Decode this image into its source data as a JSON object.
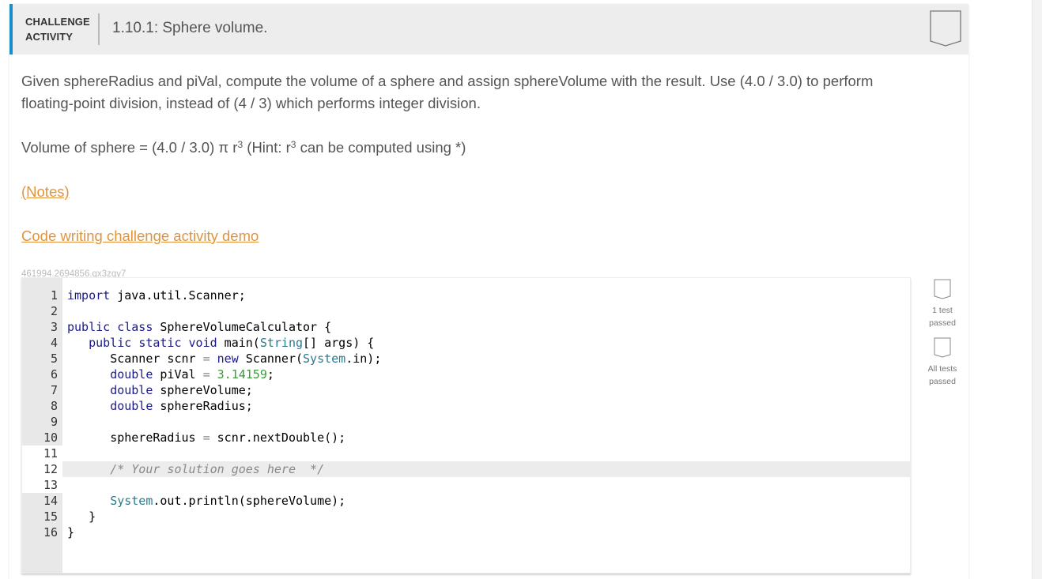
{
  "header": {
    "label_line1": "CHALLENGE",
    "label_line2": "ACTIVITY",
    "title": "1.10.1: Sphere volume.",
    "badge_icon": "completion-badge-icon",
    "accent_color": "#1a8cc7"
  },
  "instructions": {
    "paragraph": "Given sphereRadius and piVal, compute the volume of a sphere and assign sphereVolume with the result. Use (4.0 / 3.0) to perform floating-point division, instead of (4 / 3) which performs integer division.",
    "formula_prefix": "Volume of sphere = (4.0 / 3.0) π r",
    "formula_exp1": "3",
    "formula_middle": " (Hint: r",
    "formula_exp2": "3",
    "formula_suffix": " can be computed using *)"
  },
  "links": {
    "notes": "(Notes)",
    "demo": "Code writing challenge activity demo",
    "link_color": "#e2933b"
  },
  "activity_id": "461994.2694856.qx3zqy7",
  "editor": {
    "lines": [
      {
        "n": "1"
      },
      {
        "n": "2"
      },
      {
        "n": "3"
      },
      {
        "n": "4"
      },
      {
        "n": "5"
      },
      {
        "n": "6"
      },
      {
        "n": "7"
      },
      {
        "n": "8"
      },
      {
        "n": "9"
      },
      {
        "n": "10"
      },
      {
        "n": "11"
      },
      {
        "n": "12"
      },
      {
        "n": "13"
      },
      {
        "n": "14"
      },
      {
        "n": "15"
      },
      {
        "n": "16"
      }
    ],
    "tokens": {
      "l1_kw": "import",
      "l1_rest": " java.util.Scanner;",
      "l3_kw1": "public",
      "l3_kw2": "class",
      "l3_rest": " SphereVolumeCalculator {",
      "l4_kw1": "public",
      "l4_kw2": "static",
      "l4_kw3": "void",
      "l4_a": " main(",
      "l4_ty": "String",
      "l4_b": "[] args) {",
      "l5_a": "Scanner scnr ",
      "l5_eq": "=",
      "l5_kw": "new",
      "l5_b": " Scanner(",
      "l5_ty": "System",
      "l5_c": ".in);",
      "l6_kw": "double",
      "l6_a": " piVal ",
      "l6_eq": "=",
      "l6_num": "3.14159",
      "l6_b": ";",
      "l7_kw": "double",
      "l7_a": " sphereVolume;",
      "l8_kw": "double",
      "l8_a": " sphereRadius;",
      "l10_a": "sphereRadius ",
      "l10_eq": "=",
      "l10_b": " scnr.nextDouble();",
      "l12_cm": "/* Your solution goes here  */",
      "l14_ty": "System",
      "l14_a": ".out.println(sphereVolume);",
      "l15_a": "}",
      "l16_a": "}"
    }
  },
  "tests": [
    {
      "label_line1": "1 test",
      "label_line2": "passed",
      "icon": "test-badge-icon"
    },
    {
      "label_line1": "All tests",
      "label_line2": "passed",
      "icon": "test-badge-icon"
    }
  ]
}
